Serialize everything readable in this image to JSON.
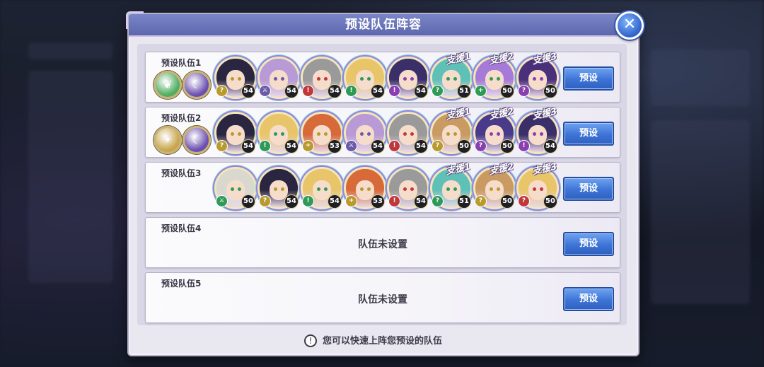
{
  "dialog": {
    "title": "预设队伍阵容",
    "close_icon": "close-icon",
    "footer_tip": "您可以快速上阵您预设的队伍",
    "tip_icon": "exclamation-icon"
  },
  "colors": {
    "header": "#5d67ad",
    "button": "#3d74d6",
    "panel": "#e9e7f0"
  },
  "teams": [
    {
      "label": "预设队伍1",
      "button_label": "预设",
      "emblems": [
        "green-leaf-emblem",
        "purple-moon-emblem"
      ],
      "members": [
        {
          "level": "54",
          "job": "?",
          "job_color": "#b99a2e",
          "hair": "#2a2540",
          "support": ""
        },
        {
          "level": "54",
          "job": "⚔",
          "job_color": "#6b5aa8",
          "hair": "#b79ad6",
          "support": ""
        },
        {
          "level": "54",
          "job": "!",
          "job_color": "#c0383a",
          "hair": "#9a9a9a",
          "support": ""
        },
        {
          "level": "54",
          "job": "!",
          "job_color": "#2f9a57",
          "hair": "#e9c56a",
          "support": ""
        },
        {
          "level": "54",
          "job": "!",
          "job_color": "#8a3fb0",
          "hair": "#3b2f6a",
          "support": ""
        },
        {
          "level": "51",
          "job": "?",
          "job_color": "#2f9a57",
          "hair": "#5fc0b8",
          "support": "支援1"
        },
        {
          "level": "50",
          "job": "+",
          "job_color": "#2f9a57",
          "hair": "#a67ad8",
          "support": "支援2"
        },
        {
          "level": "50",
          "job": "?",
          "job_color": "#8a3fb0",
          "hair": "#4a2f7a",
          "support": "支援3"
        }
      ]
    },
    {
      "label": "预设队伍2",
      "button_label": "预设",
      "emblems": [
        "gold-sun-emblem",
        "purple-moon-emblem"
      ],
      "members": [
        {
          "level": "54",
          "job": "?",
          "job_color": "#b99a2e",
          "hair": "#2a2540",
          "support": ""
        },
        {
          "level": "54",
          "job": "!",
          "job_color": "#2f9a57",
          "hair": "#e9c56a",
          "support": ""
        },
        {
          "level": "53",
          "job": "+",
          "job_color": "#b99a2e",
          "hair": "#d86a3a",
          "support": ""
        },
        {
          "level": "54",
          "job": "⚔",
          "job_color": "#6b5aa8",
          "hair": "#b79ad6",
          "support": ""
        },
        {
          "level": "54",
          "job": "!",
          "job_color": "#c0383a",
          "hair": "#9a9a9a",
          "support": ""
        },
        {
          "level": "50",
          "job": "?",
          "job_color": "#b99a2e",
          "hair": "#c99a62",
          "support": "支援1"
        },
        {
          "level": "50",
          "job": "?",
          "job_color": "#8a3fb0",
          "hair": "#4a3a8a",
          "support": "支援2"
        },
        {
          "level": "54",
          "job": "!",
          "job_color": "#8a3fb0",
          "hair": "#3b2f6a",
          "support": "支援3"
        }
      ]
    },
    {
      "label": "预设队伍3",
      "button_label": "预设",
      "emblems": [],
      "members": [
        {
          "level": "50",
          "job": "⚔",
          "job_color": "#2f9a57",
          "hair": "#d8d8cf",
          "support": ""
        },
        {
          "level": "54",
          "job": "?",
          "job_color": "#b99a2e",
          "hair": "#2a2540",
          "support": ""
        },
        {
          "level": "54",
          "job": "!",
          "job_color": "#2f9a57",
          "hair": "#e9c56a",
          "support": ""
        },
        {
          "level": "53",
          "job": "+",
          "job_color": "#b99a2e",
          "hair": "#d86a3a",
          "support": ""
        },
        {
          "level": "54",
          "job": "!",
          "job_color": "#c0383a",
          "hair": "#9a9a9a",
          "support": ""
        },
        {
          "level": "51",
          "job": "?",
          "job_color": "#2f9a57",
          "hair": "#5fc0b8",
          "support": "支援1"
        },
        {
          "level": "50",
          "job": "?",
          "job_color": "#b99a2e",
          "hair": "#c99a62",
          "support": "支援2"
        },
        {
          "level": "50",
          "job": "?",
          "job_color": "#c0383a",
          "hair": "#e9c56a",
          "support": "支援3"
        }
      ]
    },
    {
      "label": "预设队伍4",
      "button_label": "预设",
      "empty_text": "队伍未设置",
      "emblems": [],
      "members": []
    },
    {
      "label": "预设队伍5",
      "button_label": "预设",
      "empty_text": "队伍未设置",
      "emblems": [],
      "members": []
    }
  ]
}
